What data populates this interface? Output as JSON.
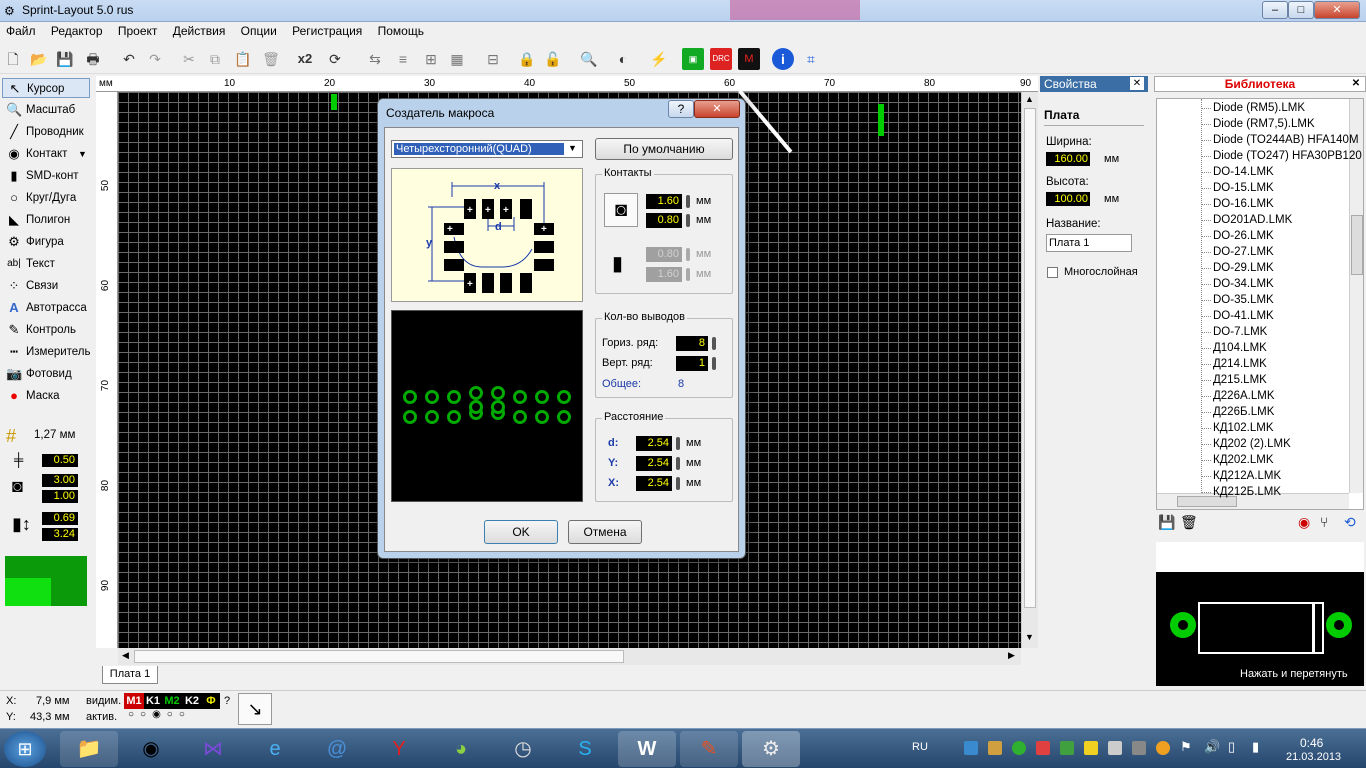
{
  "window": {
    "title": "Sprint-Layout 5.0 rus",
    "min": "–",
    "max": "□",
    "close": "✕"
  },
  "menu": [
    "Файл",
    "Редактор",
    "Проект",
    "Действия",
    "Опции",
    "Регистрация",
    "Помощь"
  ],
  "toolbar": {
    "zoom_label": "x2"
  },
  "tools": [
    {
      "label": "Курсор",
      "icon": "cursor-icon"
    },
    {
      "label": "Масштаб",
      "icon": "zoom-icon"
    },
    {
      "label": "Проводник",
      "icon": "track-icon"
    },
    {
      "label": "Контакт",
      "icon": "pad-icon"
    },
    {
      "label": "SMD-конт",
      "icon": "smd-icon"
    },
    {
      "label": "Круг/Дуга",
      "icon": "circle-icon"
    },
    {
      "label": "Полигон",
      "icon": "polygon-icon"
    },
    {
      "label": "Фигура",
      "icon": "figure-icon"
    },
    {
      "label": "Текст",
      "icon": "text-icon"
    },
    {
      "label": "Связи",
      "icon": "connections-icon"
    },
    {
      "label": "Автотрасса",
      "icon": "autoroute-icon"
    },
    {
      "label": "Контроль",
      "icon": "check-icon"
    },
    {
      "label": "Измеритель",
      "icon": "measure-icon"
    },
    {
      "label": "Фотовид",
      "icon": "photo-icon"
    },
    {
      "label": "Маска",
      "icon": "mask-icon"
    }
  ],
  "tool_settings": {
    "grid": "1,27 мм",
    "track_width": "0.50",
    "pad_outer": "3.00",
    "pad_inner": "1.00",
    "smd_w": "0.69",
    "smd_h": "3.24"
  },
  "ruler": {
    "unit": "мм",
    "top": [
      "10",
      "20",
      "30",
      "40",
      "50",
      "60",
      "70",
      "80",
      "90"
    ],
    "left": [
      "50",
      "60",
      "70",
      "80",
      "90"
    ]
  },
  "tab": "Плата 1",
  "status": {
    "x_label": "X:",
    "x_value": "7,9 мм",
    "y_label": "Y:",
    "y_value": "43,3 мм",
    "visible_label": "видим.",
    "active_label": "актив.",
    "layers": [
      "M1",
      "K1",
      "M2",
      "K2",
      "Ф"
    ],
    "help": "?"
  },
  "properties": {
    "title": "Свойства",
    "section": "Плата",
    "width_label": "Ширина:",
    "width_value": "160.00",
    "width_unit": "мм",
    "height_label": "Высота:",
    "height_value": "100.00",
    "height_unit": "мм",
    "name_label": "Название:",
    "name_value": "Плата 1",
    "multilayer_label": "Многослойная"
  },
  "library": {
    "title": "Библиотека",
    "items": [
      "Diode (RM5).LMK",
      "Diode (RM7,5).LMK",
      "Diode (TO244AB) HFA140M",
      "Diode (TO247) HFA30PB120",
      "DO-14.LMK",
      "DO-15.LMK",
      "DO-16.LMK",
      "DO201AD.LMK",
      "DO-26.LMK",
      "DO-27.LMK",
      "DO-29.LMK",
      "DO-34.LMK",
      "DO-35.LMK",
      "DO-41.LMK",
      "DO-7.LMK",
      "Д104.LMK",
      "Д214.LMK",
      "Д215.LMK",
      "Д226А.LMK",
      "Д226Б.LMK",
      "КД102.LMK",
      "КД202 (2).LMK",
      "КД202.LMK",
      "КД212А.LMK",
      "КД212Б.LMK"
    ],
    "hint": "Нажать и перетянуть"
  },
  "dialog": {
    "title": "Создатель макроса",
    "help": "?",
    "close": "✕",
    "type_value": "Четырехсторонний(QUAD)",
    "default_button": "По умолчанию",
    "contacts_title": "Контакты",
    "c1": "1.60",
    "c2": "0.80",
    "c3": "0.80",
    "c4": "1.60",
    "unit": "мм",
    "pins_title": "Кол-во выводов",
    "horiz_label": "Гориз. ряд:",
    "horiz_value": "8",
    "vert_label": "Верт. ряд:",
    "vert_value": "1",
    "total_label": "Общее:",
    "total_value": "8",
    "dist_title": "Расстояние",
    "d_label": "d:",
    "d_value": "2.54",
    "y_label": "Y:",
    "y_value": "2.54",
    "x_label": "X:",
    "x_value": "2.54",
    "diagram_x": "x",
    "diagram_y": "y",
    "diagram_d": "d",
    "ok": "OK",
    "cancel": "Отмена"
  },
  "taskbar": {
    "lang": "RU",
    "time": "0:46",
    "date": "21.03.2013"
  }
}
